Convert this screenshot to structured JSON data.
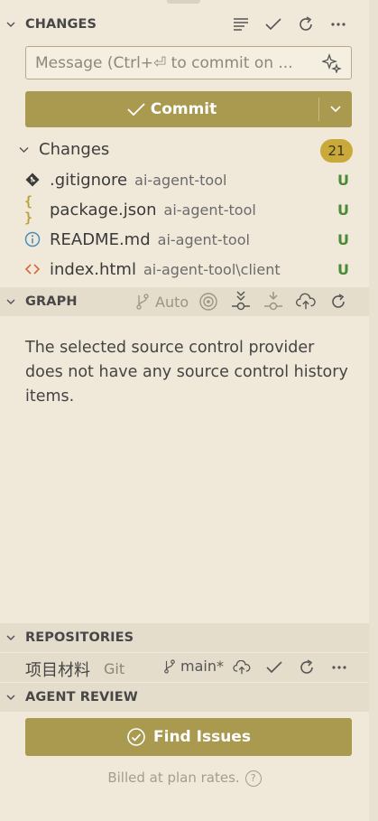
{
  "changes_section": {
    "title": "CHANGES",
    "header_icons": [
      "view-as-list-icon",
      "check-icon",
      "refresh-icon",
      "more-icon"
    ],
    "message_placeholder": "Message (Ctrl+⏎ to commit on ...",
    "commit_label": "Commit",
    "group_label": "Changes",
    "count": "21",
    "files": [
      {
        "icon": "git-file-icon",
        "name": ".gitignore",
        "path": "ai-agent-tool",
        "status": "U",
        "icon_color": "#3a3a3a"
      },
      {
        "icon": "json-braces-icon",
        "name": "package.json",
        "path": "ai-agent-tool",
        "status": "U",
        "icon_color": "#b8a33a"
      },
      {
        "icon": "info-icon",
        "name": "README.md",
        "path": "ai-agent-tool",
        "status": "U",
        "icon_color": "#4a8fb8"
      },
      {
        "icon": "html-code-icon",
        "name": "index.html",
        "path": "ai-agent-tool\\client",
        "status": "U",
        "icon_color": "#d36b38"
      }
    ]
  },
  "graph_section": {
    "title": "GRAPH",
    "auto_label": "Auto",
    "empty_message": "The selected source control provider does not have any source control history items."
  },
  "repositories_section": {
    "title": "REPOSITORIES",
    "repo_name": "项目材料",
    "repo_type": "Git",
    "branch": "main*"
  },
  "agent_review_section": {
    "title": "AGENT REVIEW",
    "button_label": "Find Issues",
    "billing_note": "Billed at plan rates."
  },
  "colors": {
    "background": "#f0e9da",
    "accent_button": "#aa9a50",
    "badge": "#c9a93a",
    "untracked_status": "#4a8a34"
  }
}
